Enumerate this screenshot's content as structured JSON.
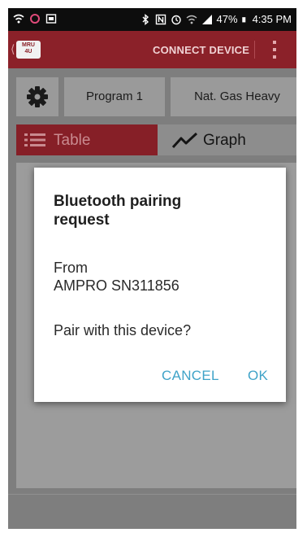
{
  "status_bar": {
    "battery": "47%",
    "time": "4:35 PM"
  },
  "header": {
    "logo_line1": "MRU",
    "logo_line2": "4U",
    "title": "CONNECT DEVICE"
  },
  "toolbar": {
    "program": "Program 1",
    "fuel": "Nat. Gas Heavy"
  },
  "tabs": [
    {
      "label": "Table",
      "icon": "list-icon",
      "active": true
    },
    {
      "label": "Graph",
      "icon": "line-chart-icon",
      "active": false
    }
  ],
  "dialog": {
    "title": "Bluetooth pairing request",
    "from_label": "From",
    "device": "AMPRO SN311856",
    "question": "Pair with this device?",
    "cancel": "CANCEL",
    "ok": "OK"
  },
  "colors": {
    "brand": "#8b2129",
    "accent": "#3fa3c8"
  }
}
